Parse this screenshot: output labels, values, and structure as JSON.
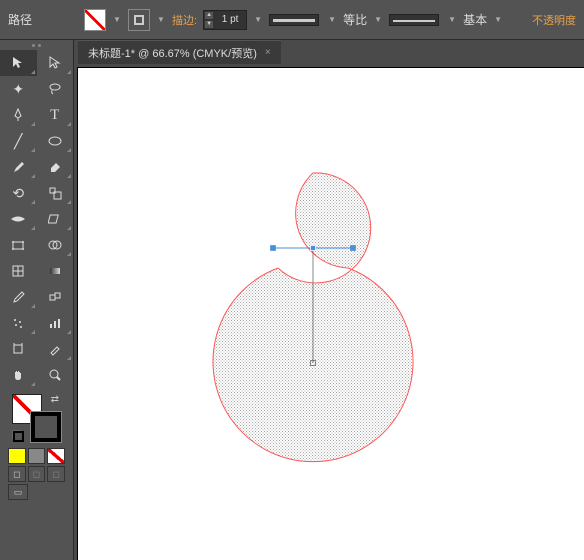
{
  "topbar": {
    "object_label": "路径",
    "stroke_label": "描边:",
    "stroke_value": "1 pt",
    "profile1_label": "等比",
    "profile2_label": "基本",
    "opacity_label": "不透明度"
  },
  "tab": {
    "title": "未标题-1* @ 66.67% (CMYK/预览)",
    "close": "×"
  },
  "tools": {
    "row_left": [
      "sel",
      "wand",
      "pen",
      "line",
      "brush",
      "rotate",
      "width",
      "freetrans",
      "mesh",
      "eyedrop",
      "symbol",
      "artboard",
      "hand"
    ],
    "row_right": [
      "dsel",
      "lasso",
      "type",
      "ellipse",
      "eraser",
      "scale",
      "warp",
      "shapebuild",
      "gradient",
      "blend",
      "graph",
      "slice",
      "zoom"
    ]
  },
  "colorrow": {
    "draw": "draw",
    "screen": "screen"
  }
}
